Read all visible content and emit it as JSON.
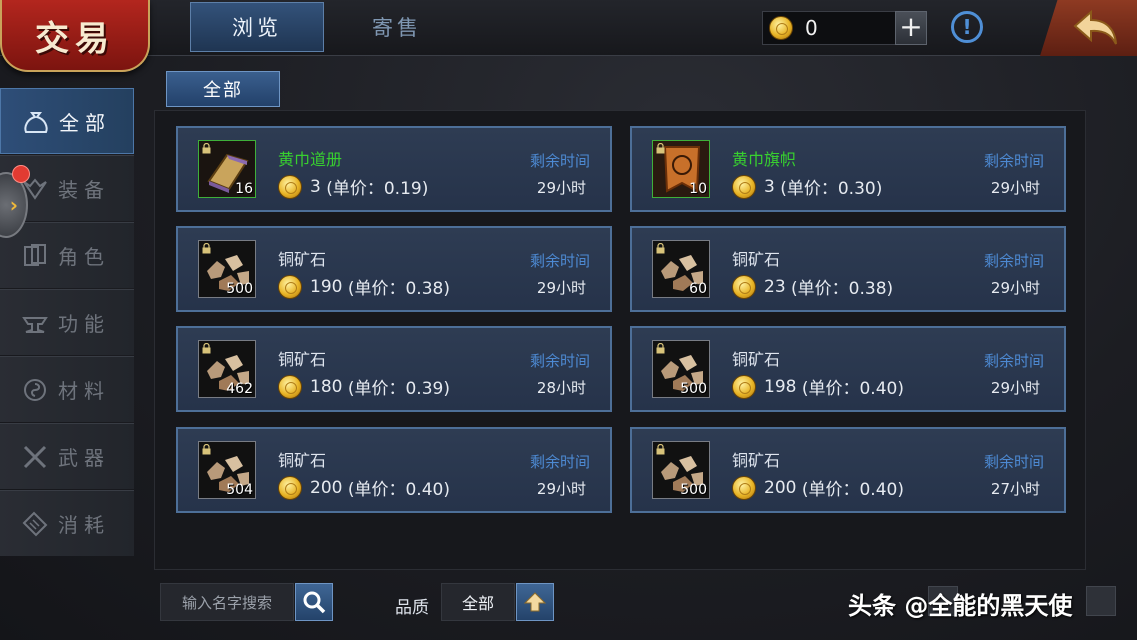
{
  "header": {
    "title": "交易",
    "tabs": [
      {
        "label": "浏览",
        "active": true
      },
      {
        "label": "寄售",
        "active": false
      }
    ],
    "coin_balance": "0"
  },
  "sidebar": {
    "items": [
      {
        "label": "全部",
        "icon": "money-bag-icon",
        "active": true
      },
      {
        "label": "装备",
        "icon": "wings-icon",
        "active": false,
        "badge": true
      },
      {
        "label": "角色",
        "icon": "cards-icon",
        "active": false
      },
      {
        "label": "功能",
        "icon": "anvil-icon",
        "active": false
      },
      {
        "label": "材料",
        "icon": "swirl-icon",
        "active": false
      },
      {
        "label": "武器",
        "icon": "crossed-swords-icon",
        "active": false
      },
      {
        "label": "消耗",
        "icon": "scroll-icon",
        "active": false
      }
    ]
  },
  "filter": {
    "category_label": "全部"
  },
  "listings": [
    {
      "name": "黄巾道册",
      "quality": "green",
      "icon": "book-icon",
      "qty": "16",
      "price": "3",
      "unit_price": "(单价：0.19)",
      "time_label": "剩余时间",
      "time_left": "29小时"
    },
    {
      "name": "黄巾旗帜",
      "quality": "green",
      "icon": "banner-icon",
      "qty": "10",
      "price": "3",
      "unit_price": "(单价：0.30)",
      "time_label": "剩余时间",
      "time_left": "29小时"
    },
    {
      "name": "铜矿石",
      "quality": "white",
      "icon": "copper-ore-icon",
      "qty": "500",
      "price": "190",
      "unit_price": "(单价：0.38)",
      "time_label": "剩余时间",
      "time_left": "29小时"
    },
    {
      "name": "铜矿石",
      "quality": "white",
      "icon": "copper-ore-icon",
      "qty": "60",
      "price": "23",
      "unit_price": "(单价：0.38)",
      "time_label": "剩余时间",
      "time_left": "29小时"
    },
    {
      "name": "铜矿石",
      "quality": "white",
      "icon": "copper-ore-icon",
      "qty": "462",
      "price": "180",
      "unit_price": "(单价：0.39)",
      "time_label": "剩余时间",
      "time_left": "28小时"
    },
    {
      "name": "铜矿石",
      "quality": "white",
      "icon": "copper-ore-icon",
      "qty": "500",
      "price": "198",
      "unit_price": "(单价：0.40)",
      "time_label": "剩余时间",
      "time_left": "29小时"
    },
    {
      "name": "铜矿石",
      "quality": "white",
      "icon": "copper-ore-icon",
      "qty": "504",
      "price": "200",
      "unit_price": "(单价：0.40)",
      "time_label": "剩余时间",
      "time_left": "29小时"
    },
    {
      "name": "铜矿石",
      "quality": "white",
      "icon": "copper-ore-icon",
      "qty": "500",
      "price": "200",
      "unit_price": "(单价：0.40)",
      "time_label": "剩余时间",
      "time_left": "27小时"
    }
  ],
  "footer": {
    "search_placeholder": "输入名字搜索",
    "quality_label": "品质",
    "quality_value": "全部"
  },
  "watermark": "头条 @全能的黑天使",
  "colors": {
    "accent": "#4d6f98",
    "green_quality": "#38d02f",
    "time_label": "#4d8ad3",
    "title_red": "#b3261e"
  }
}
